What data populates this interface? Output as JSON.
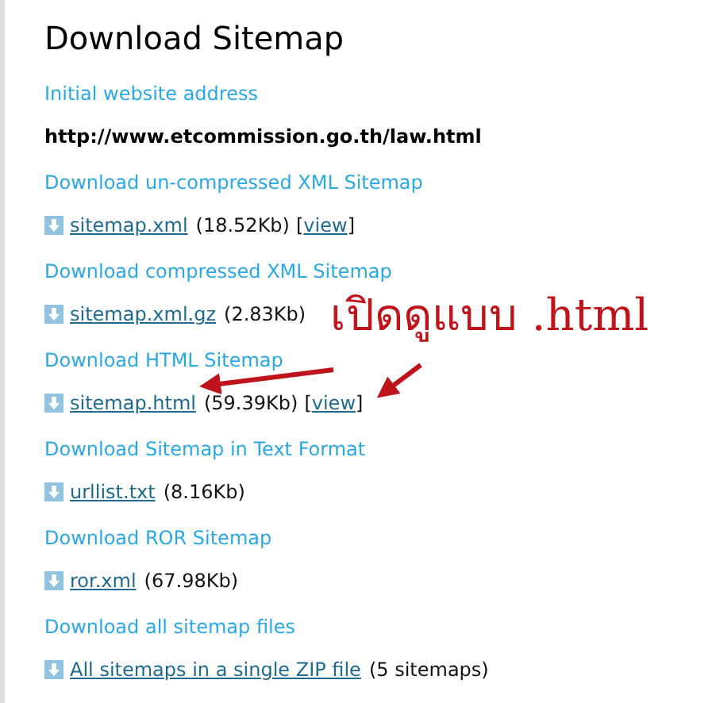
{
  "title": "Download Sitemap",
  "sections": [
    {
      "heading": "Initial website address",
      "kind": "address",
      "text": "http://www.etcommission.go.th/law.html"
    },
    {
      "heading": "Download un-compressed XML Sitemap",
      "kind": "file",
      "link": "sitemap.xml",
      "size": "(18.52Kb)",
      "view_open": "[",
      "view": "view",
      "view_close": "]"
    },
    {
      "heading": "Download compressed XML Sitemap",
      "kind": "file",
      "link": "sitemap.xml.gz",
      "size": "(2.83Kb)"
    },
    {
      "heading": "Download HTML Sitemap",
      "kind": "file",
      "link": "sitemap.html",
      "size": "(59.39Kb)",
      "view_open": "[",
      "view": "view",
      "view_close": "]"
    },
    {
      "heading": "Download Sitemap in Text Format",
      "kind": "file",
      "link": "urllist.txt",
      "size": "(8.16Kb)"
    },
    {
      "heading": "Download ROR Sitemap",
      "kind": "file",
      "link": "ror.xml",
      "size": "(67.98Kb)"
    },
    {
      "heading": "Download all sitemap files",
      "kind": "file",
      "link": "All sitemaps in a single ZIP file",
      "size": "(5 sitemaps)"
    }
  ],
  "annotation": "เปิดดูแบบ .html"
}
